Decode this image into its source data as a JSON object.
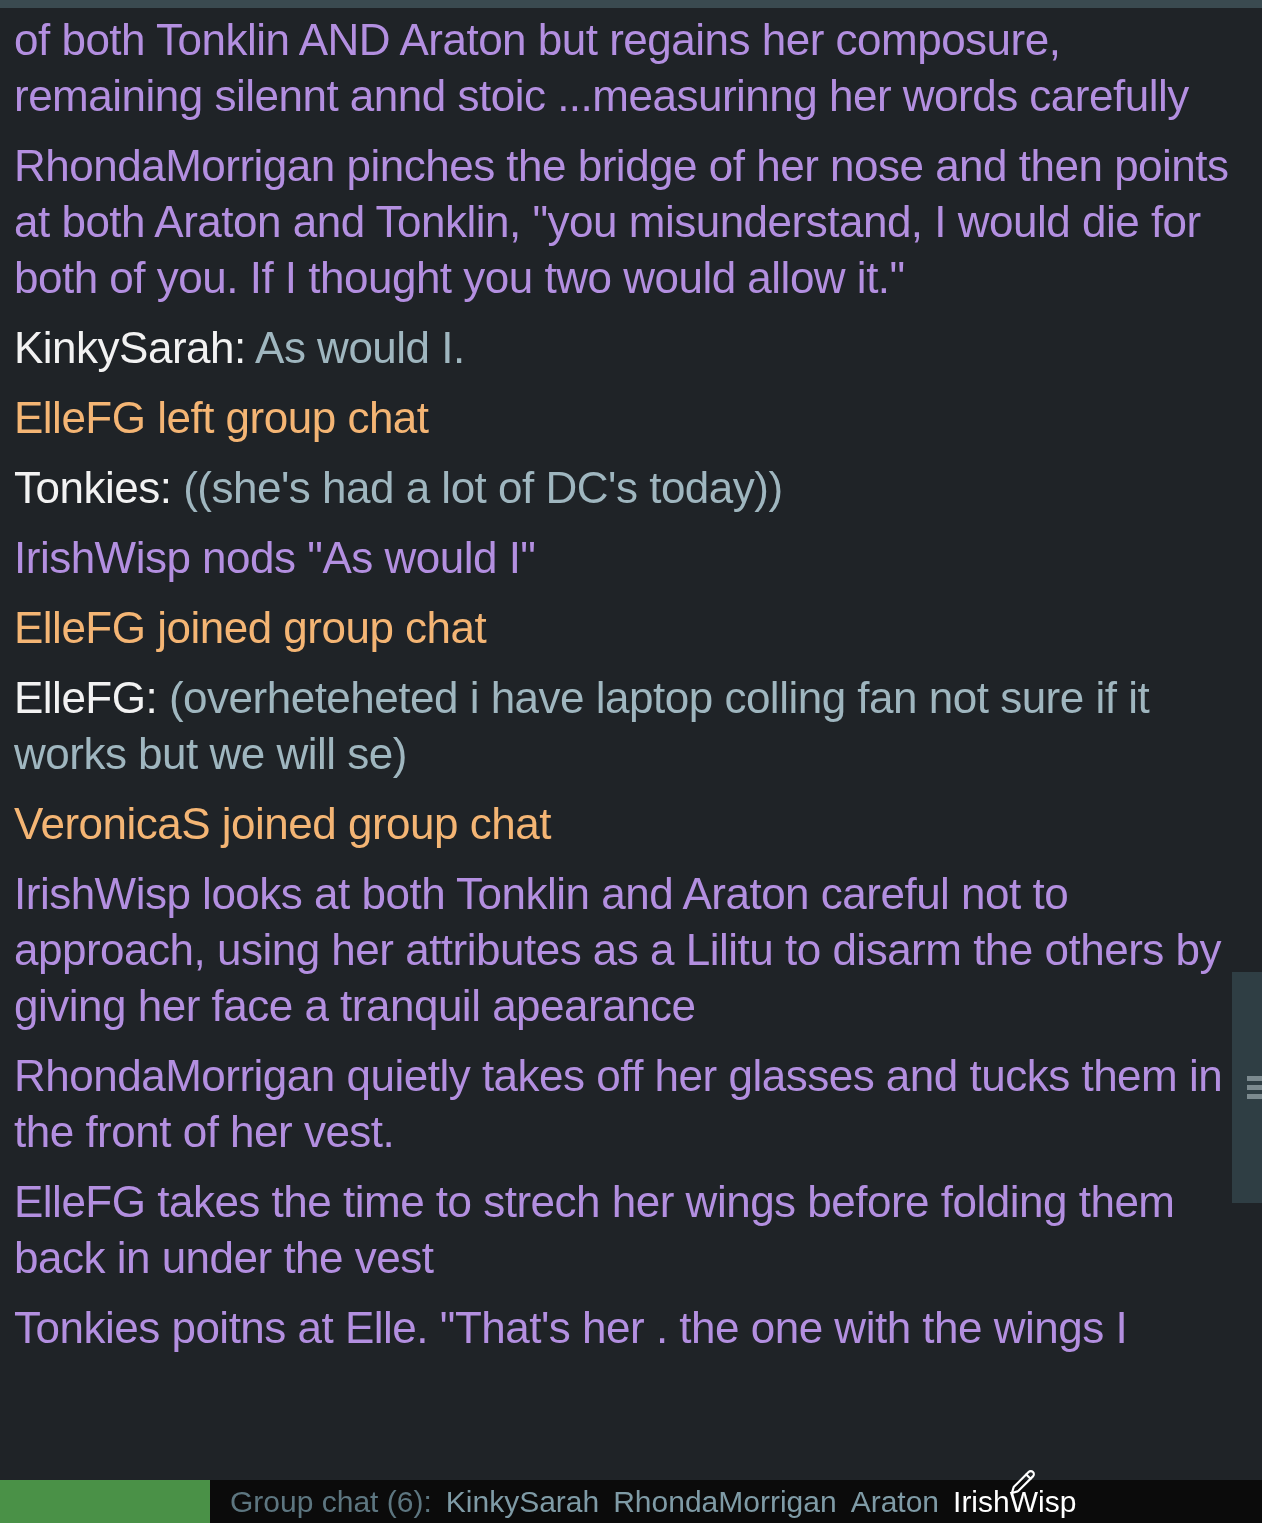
{
  "messages": [
    {
      "kind": "action",
      "text": "of both Tonklin AND Araton but regains her composure, remaining silennt annd stoic ...measurinng her words carefully"
    },
    {
      "kind": "action",
      "text": "RhondaMorrigan pinches the bridge of her nose and then points at both Araton and Tonklin, \"you misunderstand, I would die for both of you.  If I thought you two would allow it.\""
    },
    {
      "kind": "chat",
      "name": "KinkySarah:",
      "text": "As would I."
    },
    {
      "kind": "system",
      "text": "ElleFG left group chat"
    },
    {
      "kind": "chat",
      "name": "Tonkies:",
      "text": "((she's had a lot of DC's today))"
    },
    {
      "kind": "action",
      "text": "IrishWisp nods \"As would I\""
    },
    {
      "kind": "system",
      "text": "ElleFG joined group chat"
    },
    {
      "kind": "chat",
      "name": "ElleFG:",
      "text": "(overheteheted i have laptop colling fan not sure if it works but we will se)"
    },
    {
      "kind": "system",
      "text": "VeronicaS joined group chat"
    },
    {
      "kind": "action",
      "text": "IrishWisp looks at both Tonklin and Araton careful not to approach, using her attributes as a Lilitu to disarm the others by giving her face a tranquil apearance"
    },
    {
      "kind": "action",
      "text": "RhondaMorrigan quietly takes off her glasses and tucks them in the front of her vest."
    },
    {
      "kind": "action",
      "text": "ElleFG takes the time to strech her wings before folding them back in under the vest"
    },
    {
      "kind": "action",
      "text": "Tonkies poitns at Elle. \"That's her . the one with the wings I"
    }
  ],
  "status_bar": {
    "label": "Group chat (6):",
    "participants": [
      {
        "name": "KinkySarah",
        "typing": false
      },
      {
        "name": "RhondaMorrigan",
        "typing": false
      },
      {
        "name": "Araton",
        "typing": false
      },
      {
        "name": "IrishWisp",
        "typing": true
      }
    ]
  }
}
